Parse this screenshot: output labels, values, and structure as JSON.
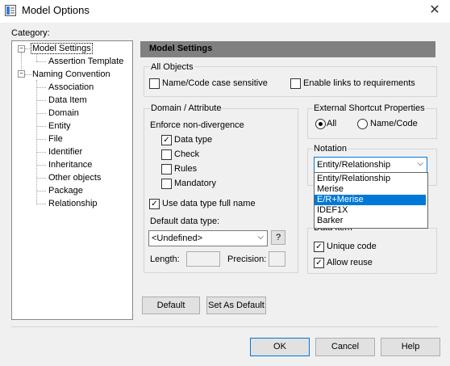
{
  "window": {
    "title": "Model Options",
    "close_glyph": "✕"
  },
  "category_label": "Category:",
  "tree": {
    "model_settings": "Model Settings",
    "assertion_template": "Assertion Template",
    "naming_convention": "Naming Convention",
    "children": [
      "Association",
      "Data Item",
      "Domain",
      "Entity",
      "File",
      "Identifier",
      "Inheritance",
      "Other objects",
      "Package",
      "Relationship"
    ]
  },
  "panel_title": "Model Settings",
  "all_objects": {
    "title": "All Objects",
    "name_code_case": "Name/Code case sensitive",
    "enable_links": "Enable links to requirements"
  },
  "domain_attr": {
    "title": "Domain / Attribute",
    "enforce": "Enforce non-divergence",
    "data_type": "Data type",
    "check": "Check",
    "rules": "Rules",
    "mandatory": "Mandatory",
    "use_full_name": "Use data type full name",
    "default_type_label": "Default data type:",
    "default_type_value": "<Undefined>",
    "help_btn": "?",
    "length": "Length:",
    "precision": "Precision:"
  },
  "shortcut": {
    "title": "External Shortcut Properties",
    "all": "All",
    "name_code": "Name/Code"
  },
  "notation": {
    "title": "Notation",
    "selected": "Entity/Relationship",
    "options": [
      "Entity/Relationship",
      "Merise",
      "E/R+Merise",
      "IDEF1X",
      "Barker"
    ],
    "highlighted_index": 2
  },
  "data_item": {
    "title": "Data Item",
    "unique_code": "Unique code",
    "allow_reuse": "Allow reuse"
  },
  "buttons": {
    "default": "Default",
    "set_as_default": "Set As Default",
    "ok": "OK",
    "cancel": "Cancel",
    "help": "Help"
  },
  "glyphs": {
    "check": "✓",
    "arrow": "⌵",
    "minus": "−"
  }
}
